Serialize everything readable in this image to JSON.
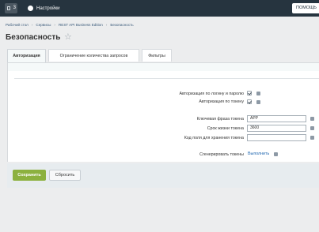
{
  "topbar": {
    "counter": "3",
    "settings_label": "Настройки",
    "help_label": "ПОМОЩЬ"
  },
  "breadcrumb": [
    "Рабочий стол",
    "Сервисы",
    "REST API Business Edition",
    "Безопасность"
  ],
  "page": {
    "title": "Безопасность"
  },
  "tabs": [
    {
      "label": "Авторизация",
      "active": true
    },
    {
      "label": "Ограничение количества запросов",
      "active": false
    },
    {
      "label": "Фильтры",
      "active": false
    }
  ],
  "form": {
    "auth_login_password": {
      "label": "Авторизация по логину и паролю",
      "checked": true
    },
    "auth_token": {
      "label": "Авторизация по токену",
      "checked": true
    },
    "token_key_phrase": {
      "label": "Ключевая фраза токена",
      "value": "APP"
    },
    "token_lifetime": {
      "label": "Срок жизни токена",
      "value": "3600"
    },
    "token_field_code": {
      "label": "Код поля для хранения токена",
      "value": ""
    },
    "generate_tokens": {
      "label": "Сгенерировать токены",
      "link": "Выполнить"
    }
  },
  "buttons": {
    "save": "Сохранить",
    "reset": "Сбросить"
  }
}
